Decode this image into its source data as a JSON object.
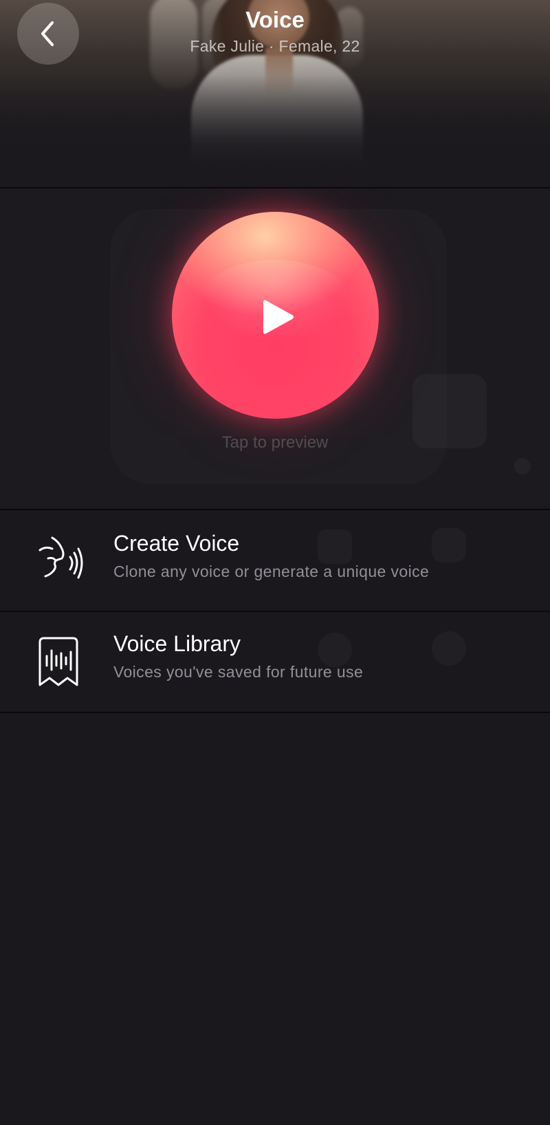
{
  "header": {
    "title": "Voice",
    "subtitle": "Fake Julie · Female, 22",
    "back_icon": "chevron-left-icon"
  },
  "preview": {
    "play_icon": "play-icon",
    "hint": "Tap to preview",
    "orb_colors": {
      "top": "#ffd0a6",
      "center": "#ff3e63",
      "edge": "#f77e76"
    }
  },
  "menu": {
    "items": [
      {
        "title": "Create Voice",
        "description": "Clone any voice or generate a unique voice",
        "icon": "speaking-head-icon"
      },
      {
        "title": "Voice Library",
        "description": "Voices you've saved for future use",
        "icon": "voice-library-bookmark-icon"
      }
    ]
  },
  "colors": {
    "background": "#1a181d",
    "divider": "#09080a",
    "accent": "#ff4466"
  }
}
